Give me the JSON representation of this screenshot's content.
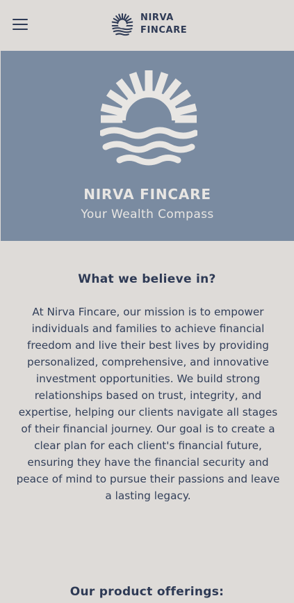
{
  "header": {
    "brand_line1": "NIRVA",
    "brand_line2": "FINCARE",
    "menu_icon": "hamburger-menu-icon",
    "logo_icon": "sun-waves-logo-icon"
  },
  "hero": {
    "title": "NIRVA FINCARE",
    "tagline": "Your Wealth Compass",
    "background_color": "#7a8ba1",
    "logo_icon": "sun-waves-logo-icon"
  },
  "beliefs": {
    "heading": "What we believe in?",
    "body": "At Nirva Fincare, our mission is to empower individuals and families to achieve financial freedom and live their best lives by providing personalized, comprehensive, and innovative investment opportunities. We build strong relationships based on trust, integrity, and expertise, helping our clients navigate all stages of their financial journey. Our goal is to create a clear plan for each client's financial future, ensuring they have the financial security and peace of mind to pursue their passions and leave a lasting legacy."
  },
  "offerings": {
    "heading": "Our product offerings:"
  },
  "colors": {
    "brand_navy": "#2e3a55",
    "page_background": "#dedbd8",
    "hero_text": "#e8e6e3"
  }
}
